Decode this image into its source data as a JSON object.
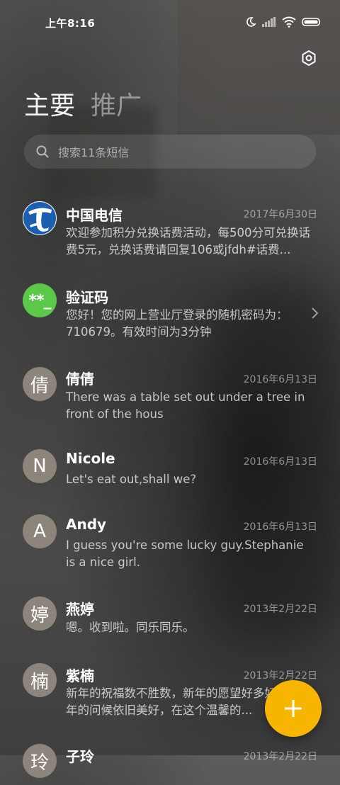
{
  "status": {
    "time": "上午8:16"
  },
  "tabs": [
    {
      "label": "主要"
    },
    {
      "label": "推广"
    }
  ],
  "search": {
    "placeholder": "搜索11条短信"
  },
  "conversations": [
    {
      "avatar": "",
      "name": "中国电信",
      "date": "2017年6月30日",
      "preview": "欢迎参加积分兑换话费活动，每500分可兑换话费5元，兑换话费请回复106或jfdh#话费..."
    },
    {
      "avatar": "**_",
      "name": "验证码",
      "date": "",
      "preview": "您好！您的网上营业厅登录的随机密码为：710679。有效时间为3分钟"
    },
    {
      "avatar": "倩",
      "name": "倩倩",
      "date": "2016年6月13日",
      "preview": "There was a table set out under a tree in front of the hous"
    },
    {
      "avatar": "N",
      "name": "Nicole",
      "date": "2016年6月13日",
      "preview": "Let's eat out,shall we?"
    },
    {
      "avatar": "A",
      "name": "Andy",
      "date": "2016年6月13日",
      "preview": "I guess you're some lucky guy.Stephanie is a nice girl."
    },
    {
      "avatar": "婷",
      "name": "燕婷",
      "date": "2013年2月22日",
      "preview": "嗯。收到啦。同乐同乐。"
    },
    {
      "avatar": "楠",
      "name": "紫楠",
      "date": "2013年2月22日",
      "preview": "新年的祝福数不胜数，新年的愿望好多好多，新年的问候依旧美好，在这个温馨的..."
    },
    {
      "avatar": "玲",
      "name": "子玲",
      "date": "2013年2月22日",
      "preview": ""
    }
  ],
  "colors": {
    "fab": "#f7b500",
    "verify_avatar": "#5cc84a",
    "contact_avatar": "#8d857c"
  },
  "icons": {
    "settings": "settings-icon",
    "search": "search-icon",
    "compose": "plus-icon"
  }
}
